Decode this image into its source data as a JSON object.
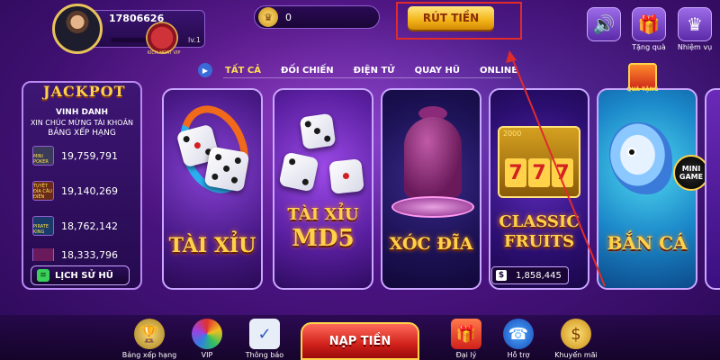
{
  "profile": {
    "id": "17806626",
    "level": "lv.1"
  },
  "badge": {
    "text": "KICH HOAT VIP"
  },
  "coins": {
    "value": "0"
  },
  "withdraw": {
    "label": "RÚT TIỀN"
  },
  "top_actions": {
    "gift_label": "Tặng quà",
    "rank_label": "Nhiệm vụ"
  },
  "tabs": [
    {
      "label": "TẤT CẢ",
      "active": true
    },
    {
      "label": "ĐỐI CHIẾN"
    },
    {
      "label": "ĐIỆN TỬ"
    },
    {
      "label": "QUAY HŨ"
    },
    {
      "label": "ONLINE"
    }
  ],
  "jackpot": {
    "title": "JACKPOT",
    "honor": "VINH DANH",
    "congrats": "XIN CHÚC MỪNG TÀI KHOẢN",
    "ranking": "BẢNG XẾP HẠNG",
    "rows": [
      {
        "thumb": "MINI POKER",
        "value": "19,759,791",
        "color": "#3a3a5a"
      },
      {
        "thumb": "TUYỆT ĐỈA CÂU ĐIÊN",
        "value": "19,140,269",
        "color": "#6a2a1a"
      },
      {
        "thumb": "PIRATE KING",
        "value": "18,762,142",
        "color": "#1a3a6a"
      },
      {
        "thumb": "",
        "value": "18,333,796",
        "color": "#6a1a5a"
      }
    ],
    "history_label": "LỊCH SỬ HŨ"
  },
  "games": [
    {
      "title": "TÀI XỈU"
    },
    {
      "title_line1": "TÀI XỈU",
      "title_line2": "MD5"
    },
    {
      "title": "XÓC ĐĨA"
    },
    {
      "title_line1": "CLASSIC",
      "title_line2": "FRUITS",
      "slot_top": "2000",
      "reels": [
        "7",
        "7",
        "7"
      ],
      "jackpot_value": "1,858,445"
    },
    {
      "title": "BẮN CÁ",
      "mini_game_line1": "MINI",
      "mini_game_line2": "GAME"
    }
  ],
  "gift_box": {
    "label": "QUÀ TẶNG"
  },
  "bottom_nav": [
    {
      "label": "Bảng xếp hạng",
      "icon": "trophy-icon"
    },
    {
      "label": "VIP",
      "icon": "wheel-icon"
    },
    {
      "label": "Thông báo",
      "icon": "calendar-icon"
    },
    {
      "label": "Đại lý",
      "icon": "gift-icon"
    },
    {
      "label": "Hỗ trợ",
      "icon": "support-icon"
    },
    {
      "label": "Khuyến mãi",
      "icon": "coin-icon"
    }
  ],
  "deposit": {
    "label": "NẠP TIỀN"
  },
  "colors": {
    "accent": "#ffd24a",
    "annotation_red": "#e02b2b",
    "background": "#4a1380"
  }
}
